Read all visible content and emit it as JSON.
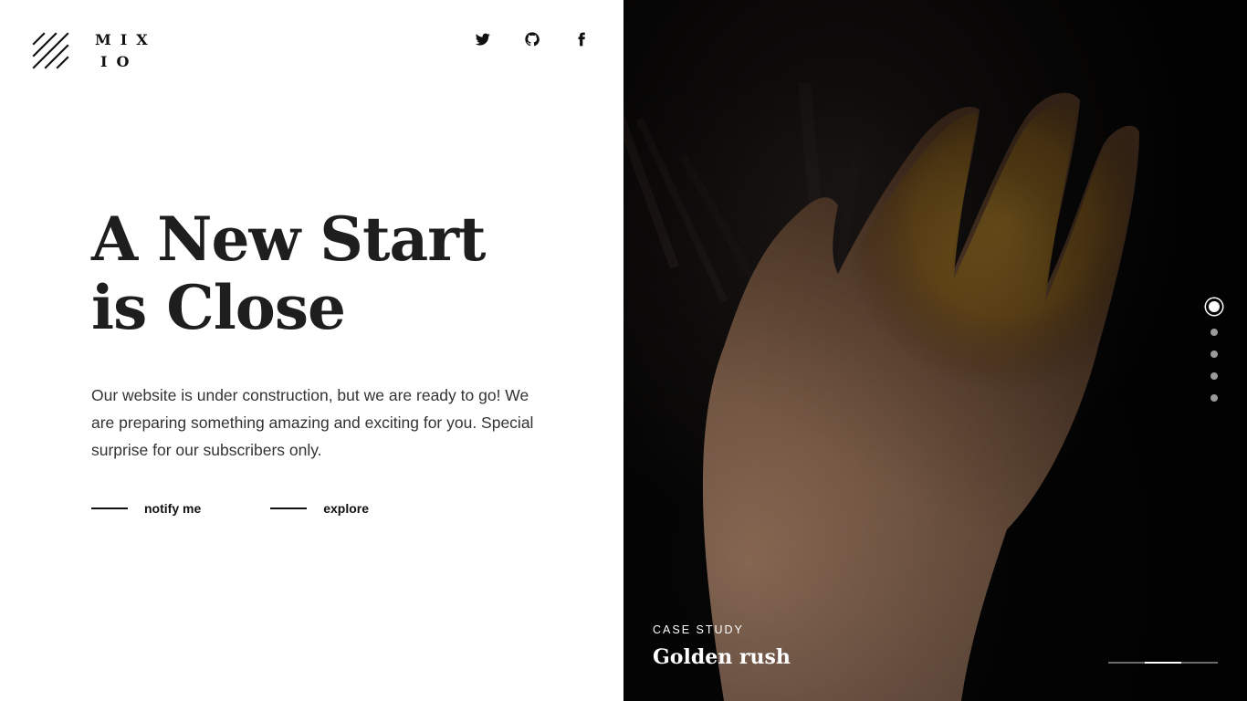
{
  "brand": {
    "logo_line1": "MIX",
    "logo_line2": "IO",
    "logo_icon": "diagonal-stripes-logo"
  },
  "social": [
    {
      "name": "twitter",
      "icon": "twitter-icon"
    },
    {
      "name": "github",
      "icon": "github-icon"
    },
    {
      "name": "facebook",
      "icon": "facebook-icon"
    }
  ],
  "hero": {
    "title_line1": "A New Start",
    "title_line2": "is Close",
    "description": "Our website is under construction, but we are ready to go! We are preparing something amazing and exciting for you. Special surprise for our subscribers only."
  },
  "actions": {
    "notify_label": "notify me",
    "explore_label": "explore"
  },
  "slider": {
    "case_label": "CASE STUDY",
    "case_title": "Golden rush",
    "total_slides": 5,
    "active_slide": 1,
    "progress": {
      "start": 0.333,
      "end": 0.667
    }
  },
  "colors": {
    "text_dark": "#1e1e1e",
    "panel_dark": "#050505",
    "accent_gold": "#b8892a",
    "skin": "#8a6a55"
  }
}
